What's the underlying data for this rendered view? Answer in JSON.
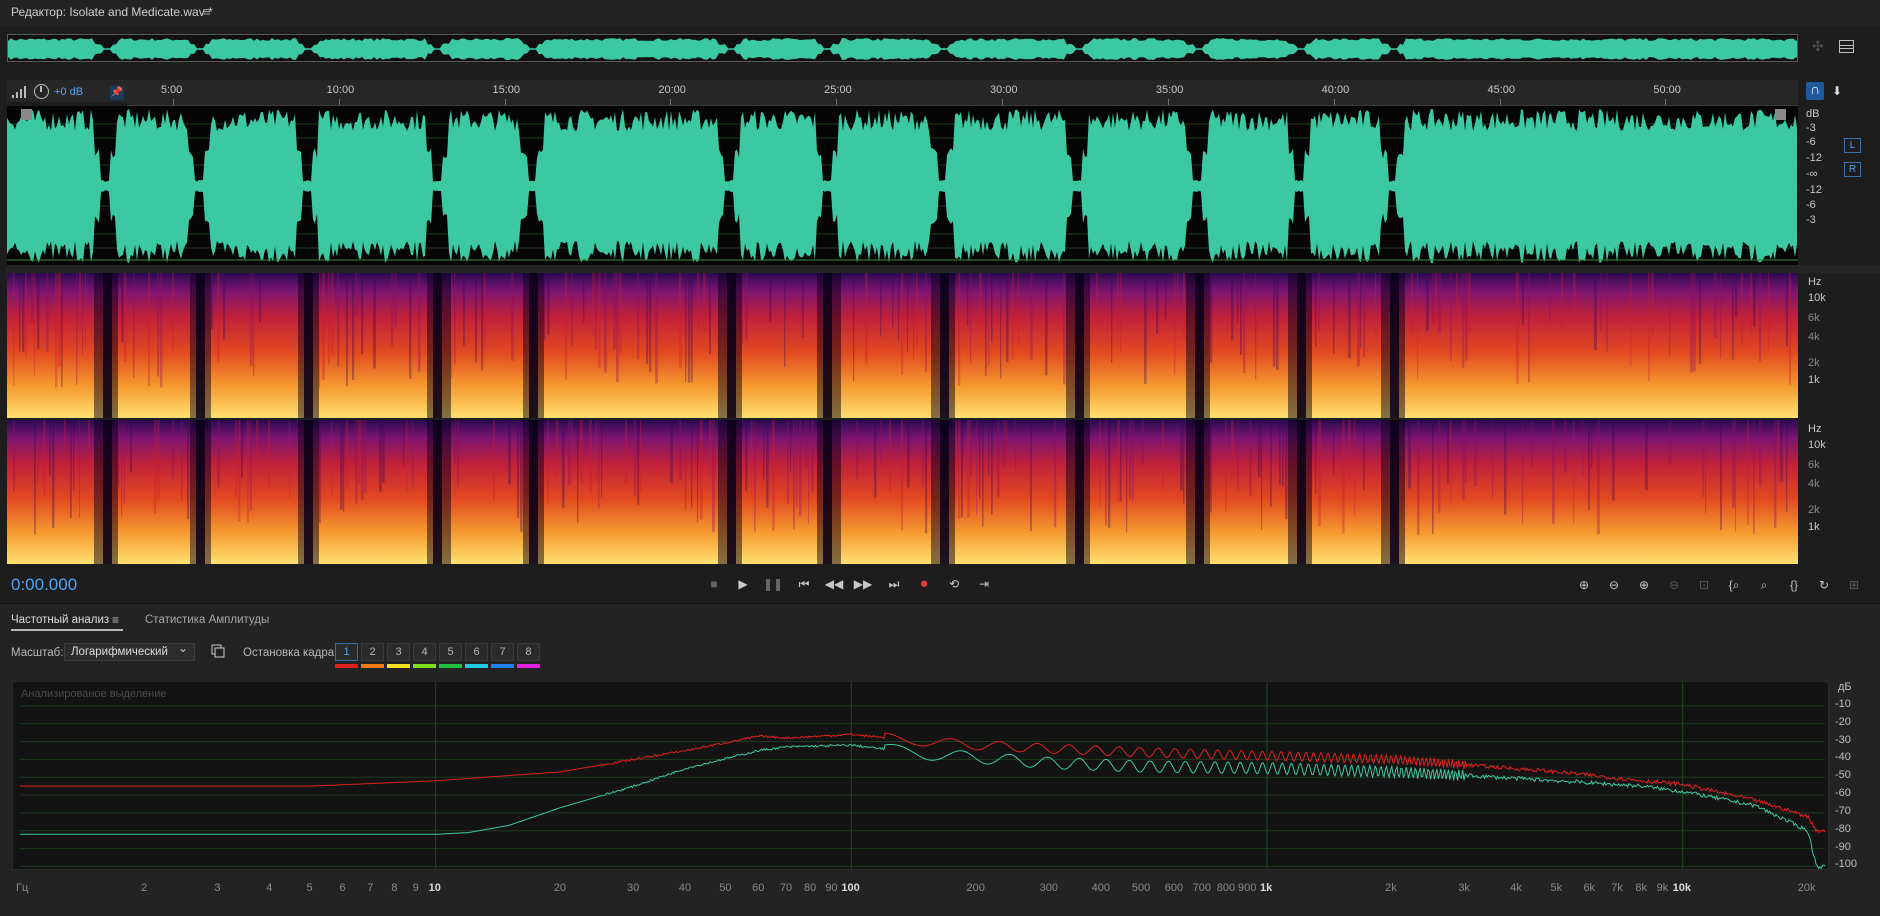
{
  "titlebar": {
    "title": "Редактор: Isolate and Medicate.wav *",
    "menu_icon": "hamburger-icon"
  },
  "level": {
    "db_label": "+0 dB"
  },
  "ruler": {
    "ticks": [
      "5:00",
      "10:00",
      "15:00",
      "20:00",
      "25:00",
      "30:00",
      "35:00",
      "40:00",
      "45:00",
      "50:00"
    ]
  },
  "waveform": {
    "color": "#3cc8a0",
    "scale_labels": [
      "dB",
      "-3",
      "-6",
      "-12",
      "-∞",
      "-12",
      "-6",
      "-3"
    ],
    "channels": [
      "L",
      "R"
    ]
  },
  "spectral": {
    "scale_labels": [
      "Hz",
      "10k",
      "6k",
      "4k",
      "2k",
      "1k"
    ]
  },
  "transport": {
    "timecode": "0:00.000",
    "buttons": [
      "stop-icon",
      "play-icon",
      "pause-icon",
      "skip-start-icon",
      "rewind-icon",
      "fast-forward-icon",
      "skip-end-icon",
      "record-icon",
      "loop-icon",
      "skip-selection-icon"
    ],
    "zoom_buttons": [
      "zoom-in-amplitude-icon",
      "zoom-out-amplitude-icon",
      "zoom-in-time-icon",
      "zoom-out-time-icon",
      "zoom-full-icon",
      "zoom-in-left-icon",
      "zoom-in-right-icon",
      "zoom-selection-icon",
      "zoom-fit-icon",
      "zoom-reset-icon"
    ],
    "record_color": "#e23a3a"
  },
  "panel": {
    "tabs": [
      "Частотный анализ",
      "Статистика Амплитуды"
    ],
    "scale_label": "Масштаб:",
    "scale_value": "Логарифмический",
    "freeze_label": "Остановка кадра:",
    "freeze_buttons": [
      "1",
      "2",
      "3",
      "4",
      "5",
      "6",
      "7",
      "8"
    ],
    "freeze_colors": [
      "#e02020",
      "#f07a10",
      "#f0e020",
      "#80e020",
      "#20c040",
      "#20c8e0",
      "#2080f0",
      "#e020e0"
    ],
    "caption": "Анализированое выделение"
  },
  "chart_data": {
    "type": "line",
    "title": "",
    "xlabel": "Гц",
    "ylabel": "дБ",
    "x_scale": "log",
    "xlim": [
      1,
      22000
    ],
    "ylim": [
      -102,
      0
    ],
    "y_ticks": [
      "дБ",
      "-10",
      "-20",
      "-30",
      "-40",
      "-50",
      "-60",
      "-70",
      "-80",
      "-90",
      "-100"
    ],
    "x_ticks": [
      {
        "v": 1,
        "t": "Гц"
      },
      {
        "v": 2,
        "t": "2"
      },
      {
        "v": 3,
        "t": "3"
      },
      {
        "v": 4,
        "t": "4"
      },
      {
        "v": 5,
        "t": "5"
      },
      {
        "v": 6,
        "t": "6"
      },
      {
        "v": 7,
        "t": "7"
      },
      {
        "v": 8,
        "t": "8"
      },
      {
        "v": 9,
        "t": "9"
      },
      {
        "v": 10,
        "t": "10",
        "b": true
      },
      {
        "v": 20,
        "t": "20"
      },
      {
        "v": 30,
        "t": "30"
      },
      {
        "v": 40,
        "t": "40"
      },
      {
        "v": 50,
        "t": "50"
      },
      {
        "v": 60,
        "t": "60"
      },
      {
        "v": 70,
        "t": "70"
      },
      {
        "v": 80,
        "t": "80"
      },
      {
        "v": 90,
        "t": "90"
      },
      {
        "v": 100,
        "t": "100",
        "b": true
      },
      {
        "v": 200,
        "t": "200"
      },
      {
        "v": 300,
        "t": "300"
      },
      {
        "v": 400,
        "t": "400"
      },
      {
        "v": 500,
        "t": "500"
      },
      {
        "v": 600,
        "t": "600"
      },
      {
        "v": 700,
        "t": "700"
      },
      {
        "v": 800,
        "t": "800"
      },
      {
        "v": 900,
        "t": "900"
      },
      {
        "v": 1000,
        "t": "1k",
        "b": true
      },
      {
        "v": 2000,
        "t": "2k"
      },
      {
        "v": 3000,
        "t": "3k"
      },
      {
        "v": 4000,
        "t": "4k"
      },
      {
        "v": 5000,
        "t": "5k"
      },
      {
        "v": 6000,
        "t": "6k"
      },
      {
        "v": 7000,
        "t": "7k"
      },
      {
        "v": 8000,
        "t": "8k"
      },
      {
        "v": 9000,
        "t": "9k"
      },
      {
        "v": 10000,
        "t": "10k",
        "b": true
      },
      {
        "v": 20000,
        "t": "20k"
      }
    ],
    "series": [
      {
        "color": "#e02020",
        "x": [
          1,
          5,
          10,
          20,
          30,
          40,
          60,
          70,
          100,
          150,
          200,
          300,
          500,
          1000,
          2000,
          3000,
          5000,
          8000,
          10000,
          15000,
          20000,
          21000
        ],
        "y": [
          -55,
          -55,
          -52,
          -47,
          -40,
          -35,
          -27,
          -28,
          -26,
          -30,
          -32,
          -34,
          -36,
          -38,
          -40,
          -43,
          -47,
          -52,
          -54,
          -63,
          -72,
          -80
        ]
      },
      {
        "color": "#3cc8a0",
        "x": [
          1,
          5,
          10,
          12,
          15,
          20,
          30,
          40,
          60,
          70,
          100,
          150,
          200,
          300,
          500,
          1000,
          2000,
          3000,
          5000,
          8000,
          10000,
          15000,
          20000,
          21000
        ],
        "y": [
          -82,
          -82,
          -82,
          -81,
          -77,
          -67,
          -55,
          -45,
          -35,
          -33,
          -32,
          -37,
          -39,
          -42,
          -44,
          -45,
          -47,
          -49,
          -52,
          -55,
          -58,
          -66,
          -80,
          -100
        ]
      }
    ]
  }
}
